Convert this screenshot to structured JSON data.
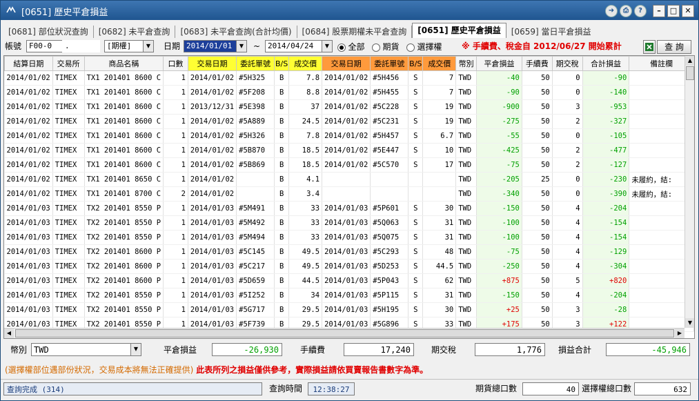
{
  "window": {
    "title": "[0651] 歷史平倉損益"
  },
  "tabs": [
    {
      "label": "[0681] 部位狀況查詢"
    },
    {
      "label": "[0682] 未平倉查詢"
    },
    {
      "label": "[0683] 未平倉查詢(合計均價)"
    },
    {
      "label": "[0684] 股票期權未平倉查詢"
    },
    {
      "label": "[0651] 歷史平倉損益"
    },
    {
      "label": "[0659] 當日平倉損益"
    }
  ],
  "toolbar": {
    "account_label": "帳號",
    "account_value": "F00-0",
    "account_dot": ".",
    "type_value": "[期權]",
    "date_label": "日期",
    "date_from": "2014/01/01",
    "tilde": "~",
    "date_to": "2014/04/24",
    "radio_all": "全部",
    "radio_futures": "期貨",
    "radio_options": "選擇權",
    "notice": "※ 手續費、稅金自 2012/06/27 開始累計",
    "query_button": "查 詢"
  },
  "colors": {
    "header_yellow": "#ffff33",
    "header_orange": "#ff9a3c",
    "profit": "#e00000",
    "loss": "#00a000"
  },
  "table": {
    "headers": [
      "結算日期",
      "交易所",
      "商品名稱",
      "口數",
      "交易日期",
      "委託單號",
      "B/S",
      "成交價",
      "交易日期",
      "委託單號",
      "B/S",
      "成交價",
      "幣別",
      "平倉損益",
      "手續費",
      "期交稅",
      "合計損益",
      "備註欄"
    ],
    "rows": [
      [
        "2014/01/02",
        "TIMEX",
        "TX1 201401 8600 C",
        "1",
        "2014/01/02",
        "#5H325",
        "B",
        "7.8",
        "2014/01/02",
        "#5H456",
        "S",
        "7",
        "TWD",
        "-40",
        "50",
        "0",
        "-90",
        ""
      ],
      [
        "2014/01/02",
        "TIMEX",
        "TX1 201401 8600 C",
        "1",
        "2014/01/02",
        "#5F208",
        "B",
        "8.8",
        "2014/01/02",
        "#5H455",
        "S",
        "7",
        "TWD",
        "-90",
        "50",
        "0",
        "-140",
        ""
      ],
      [
        "2014/01/02",
        "TIMEX",
        "TX1 201401 8600 C",
        "1",
        "2013/12/31",
        "#5E398",
        "B",
        "37",
        "2014/01/02",
        "#5C228",
        "S",
        "19",
        "TWD",
        "-900",
        "50",
        "3",
        "-953",
        ""
      ],
      [
        "2014/01/02",
        "TIMEX",
        "TX1 201401 8600 C",
        "1",
        "2014/01/02",
        "#5A889",
        "B",
        "24.5",
        "2014/01/02",
        "#5C231",
        "S",
        "19",
        "TWD",
        "-275",
        "50",
        "2",
        "-327",
        ""
      ],
      [
        "2014/01/02",
        "TIMEX",
        "TX1 201401 8600 C",
        "1",
        "2014/01/02",
        "#5H326",
        "B",
        "7.8",
        "2014/01/02",
        "#5H457",
        "S",
        "6.7",
        "TWD",
        "-55",
        "50",
        "0",
        "-105",
        ""
      ],
      [
        "2014/01/02",
        "TIMEX",
        "TX1 201401 8600 C",
        "1",
        "2014/01/02",
        "#5B870",
        "B",
        "18.5",
        "2014/01/02",
        "#5E447",
        "S",
        "10",
        "TWD",
        "-425",
        "50",
        "2",
        "-477",
        ""
      ],
      [
        "2014/01/02",
        "TIMEX",
        "TX1 201401 8600 C",
        "1",
        "2014/01/02",
        "#5B869",
        "B",
        "18.5",
        "2014/01/02",
        "#5C570",
        "S",
        "17",
        "TWD",
        "-75",
        "50",
        "2",
        "-127",
        ""
      ],
      [
        "2014/01/02",
        "TIMEX",
        "TX1 201401 8650 C",
        "1",
        "2014/01/02",
        "",
        "B",
        "4.1",
        "",
        "",
        "",
        "",
        "TWD",
        "-205",
        "25",
        "0",
        "-230",
        "未履約，結:"
      ],
      [
        "2014/01/02",
        "TIMEX",
        "TX1 201401 8700 C",
        "2",
        "2014/01/02",
        "",
        "B",
        "3.4",
        "",
        "",
        "",
        "",
        "TWD",
        "-340",
        "50",
        "0",
        "-390",
        "未履約，結:"
      ],
      [
        "2014/01/03",
        "TIMEX",
        "TX2 201401 8550 P",
        "1",
        "2014/01/03",
        "#5M491",
        "B",
        "33",
        "2014/01/03",
        "#5P601",
        "S",
        "30",
        "TWD",
        "-150",
        "50",
        "4",
        "-204",
        ""
      ],
      [
        "2014/01/03",
        "TIMEX",
        "TX2 201401 8550 P",
        "1",
        "2014/01/03",
        "#5M492",
        "B",
        "33",
        "2014/01/03",
        "#5Q063",
        "S",
        "31",
        "TWD",
        "-100",
        "50",
        "4",
        "-154",
        ""
      ],
      [
        "2014/01/03",
        "TIMEX",
        "TX2 201401 8550 P",
        "1",
        "2014/01/03",
        "#5M494",
        "B",
        "33",
        "2014/01/03",
        "#5Q075",
        "S",
        "31",
        "TWD",
        "-100",
        "50",
        "4",
        "-154",
        ""
      ],
      [
        "2014/01/03",
        "TIMEX",
        "TX2 201401 8600 P",
        "1",
        "2014/01/03",
        "#5C145",
        "B",
        "49.5",
        "2014/01/03",
        "#5C293",
        "S",
        "48",
        "TWD",
        "-75",
        "50",
        "4",
        "-129",
        ""
      ],
      [
        "2014/01/03",
        "TIMEX",
        "TX2 201401 8600 P",
        "1",
        "2014/01/03",
        "#5C217",
        "B",
        "49.5",
        "2014/01/03",
        "#5D253",
        "S",
        "44.5",
        "TWD",
        "-250",
        "50",
        "4",
        "-304",
        ""
      ],
      [
        "2014/01/03",
        "TIMEX",
        "TX2 201401 8600 P",
        "1",
        "2014/01/03",
        "#5D659",
        "B",
        "44.5",
        "2014/01/03",
        "#5P043",
        "S",
        "62",
        "TWD",
        "+875",
        "50",
        "5",
        "+820",
        ""
      ],
      [
        "2014/01/03",
        "TIMEX",
        "TX2 201401 8550 P",
        "1",
        "2014/01/03",
        "#5I252",
        "B",
        "34",
        "2014/01/03",
        "#5P115",
        "S",
        "31",
        "TWD",
        "-150",
        "50",
        "4",
        "-204",
        ""
      ],
      [
        "2014/01/03",
        "TIMEX",
        "TX2 201401 8550 P",
        "1",
        "2014/01/03",
        "#5G717",
        "B",
        "29.5",
        "2014/01/03",
        "#5H195",
        "S",
        "30",
        "TWD",
        "+25",
        "50",
        "3",
        "-28",
        ""
      ],
      [
        "2014/01/03",
        "TIMEX",
        "TX2 201401 8550 P",
        "1",
        "2014/01/03",
        "#5F739",
        "B",
        "29.5",
        "2014/01/03",
        "#5G896",
        "S",
        "33",
        "TWD",
        "+175",
        "50",
        "3",
        "+122",
        ""
      ]
    ]
  },
  "summary": {
    "currency_label": "幣別",
    "currency_value": "TWD",
    "pnl_label": "平倉損益",
    "pnl_value": "-26,930",
    "fee_label": "手續費",
    "fee_value": "17,240",
    "tax_label": "期交稅",
    "tax_value": "1,776",
    "total_label": "損益合計",
    "total_value": "-45,946"
  },
  "warning": {
    "note": "(選擇權部位遇部份狀況，交易成本將無法正確提供)",
    "disclaimer": "此表所列之損益僅供參考，實際損益請依買賣報告書數字為準。"
  },
  "status": {
    "message": "查詢完成 (314)",
    "time_label": "查詢時間",
    "time_value": "12:38:27",
    "futures_lots_label": "期貨總口數",
    "futures_lots_value": "40",
    "options_lots_label": "選擇權總口數",
    "options_lots_value": "632"
  }
}
